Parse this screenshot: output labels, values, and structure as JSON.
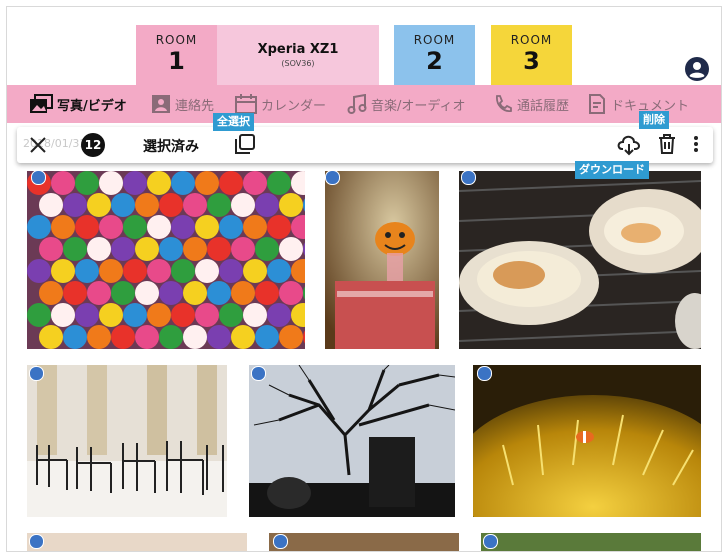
{
  "rooms": [
    {
      "label": "ROOM",
      "number": "1"
    },
    {
      "label": "ROOM",
      "number": "2"
    },
    {
      "label": "ROOM",
      "number": "3"
    }
  ],
  "device": {
    "name": "Xperia XZ1",
    "model": "(SOV36)"
  },
  "tabs": [
    {
      "label": "写真/ビデオ",
      "icon": "photo-video-icon"
    },
    {
      "label": "連絡先",
      "icon": "contacts-icon"
    },
    {
      "label": "カレンダー",
      "icon": "calendar-icon"
    },
    {
      "label": "音楽/オーディオ",
      "icon": "music-icon"
    },
    {
      "label": "通話履歴",
      "icon": "phone-icon"
    },
    {
      "label": "ドキュメント",
      "icon": "document-icon"
    }
  ],
  "selection": {
    "count": "12",
    "label": "選択済み",
    "ghost_date": "2018/01/31"
  },
  "tooltips": {
    "select_all": "全選択",
    "delete": "削除",
    "download": "ダウンロード"
  },
  "colors": {
    "room1": "#f3aac6",
    "room2": "#8cc2ec",
    "room3": "#f5d63a",
    "tabbar": "#f3aac6",
    "tooltip": "#2f9bd1",
    "check": "#3b73c4"
  },
  "photos": [
    {
      "subject": "colorful gumballs",
      "checked": true
    },
    {
      "subject": "pumpkin figure",
      "checked": true
    },
    {
      "subject": "grilled scallops",
      "checked": true
    },
    {
      "subject": "cafe chairs",
      "checked": true
    },
    {
      "subject": "tree silhouette with drink",
      "checked": true
    },
    {
      "subject": "sea anemone",
      "checked": true
    },
    {
      "subject": "photo partial 1",
      "checked": true
    },
    {
      "subject": "photo partial 2",
      "checked": true
    },
    {
      "subject": "photo partial 3",
      "checked": true
    }
  ]
}
